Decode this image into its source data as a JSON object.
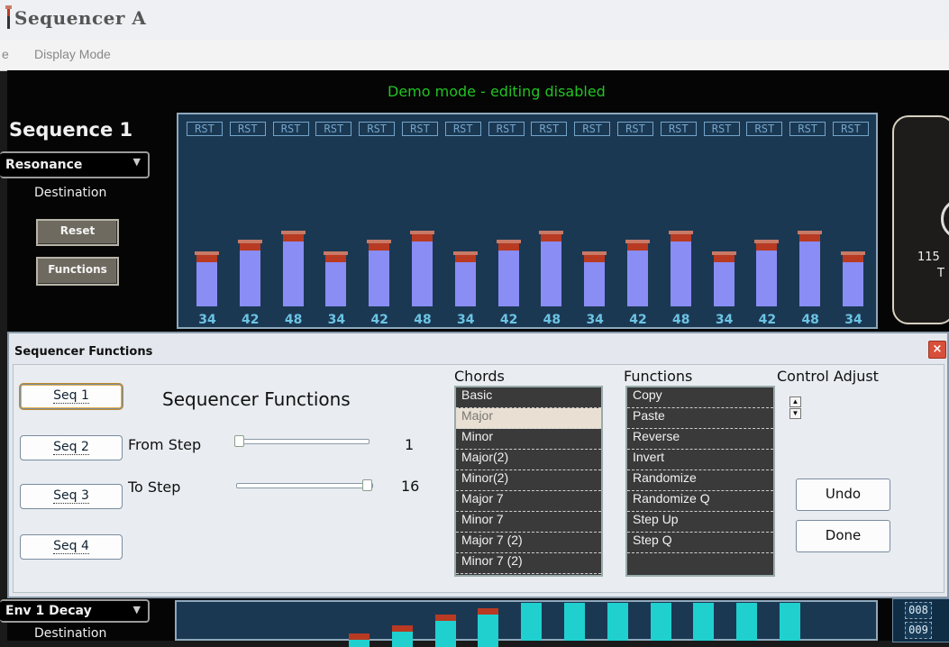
{
  "window": {
    "title": "Sequencer A"
  },
  "menu": {
    "items": [
      "e",
      "Display Mode"
    ]
  },
  "app": {
    "demo_text": "Demo mode - editing disabled",
    "sequence_title": "Sequence 1",
    "destination_select": "Resonance",
    "destination_label": "Destination",
    "reset_button": "Reset",
    "functions_button": "Functions",
    "step_label": "RST",
    "step_values": [
      34,
      42,
      48,
      34,
      42,
      48,
      34,
      42,
      48,
      34,
      42,
      48,
      34,
      42,
      48,
      34
    ],
    "knob_value": "115",
    "knob_label": "T"
  },
  "dialog": {
    "title": "Sequencer Functions",
    "close_icon": "close-icon",
    "heading": "Sequencer Functions",
    "seq_buttons": [
      "Seq 1",
      "Seq 2",
      "Seq 3",
      "Seq 4"
    ],
    "selected_seq": "Seq 1",
    "from_step_label": "From Step",
    "from_step_value": "1",
    "to_step_label": "To Step",
    "to_step_value": "16",
    "chords_header": "Chords",
    "chords": [
      "Basic",
      "Major",
      "Minor",
      "Major(2)",
      "Minor(2)",
      "Major 7",
      "Minor 7",
      "Major 7 (2)",
      "Minor 7 (2)"
    ],
    "selected_chord": "Major",
    "functions_header": "Functions",
    "functions": [
      "Copy",
      "Paste",
      "Reverse",
      "Invert",
      "Randomize",
      "Randomize Q",
      "Step Up",
      "Step Q"
    ],
    "control_adjust_header": "Control Adjust",
    "undo_button": "Undo",
    "done_button": "Done"
  },
  "bottom": {
    "destination_select": "Env 1 Decay",
    "destination_label": "Destination",
    "numbers": [
      "008",
      "009"
    ]
  },
  "colors": {
    "demo_text": "#22c322",
    "bar_fill": "#8a8df4",
    "bar_cap": "#b83a22",
    "panel_bg": "#1b3853",
    "bottom_bar_fill": "#1fd0cf",
    "step_value_text": "#6cc4e4"
  }
}
